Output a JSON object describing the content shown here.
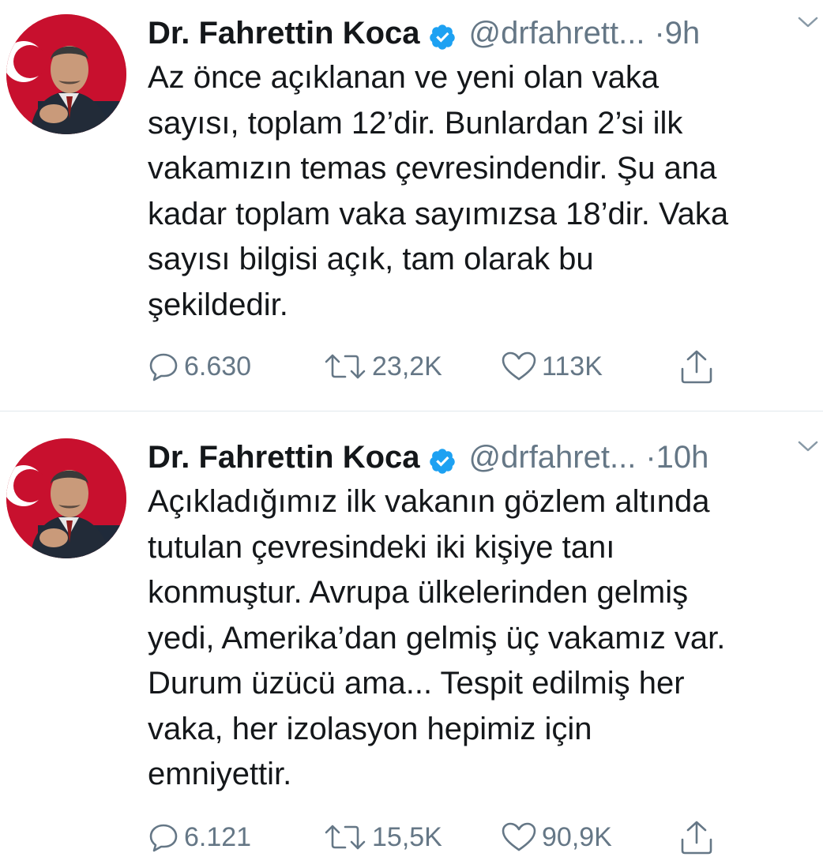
{
  "colors": {
    "text": "#14171a",
    "secondary": "#657786",
    "verified": "#1da1f2",
    "divider": "#e1e8ed"
  },
  "tweets": [
    {
      "author": {
        "name": "Dr. Fahrettin Koca",
        "handle": "@drfahrett...",
        "verified": true
      },
      "separator": "·",
      "time": "9h",
      "text": "Az önce açıklanan ve yeni olan vaka\nsayısı, toplam 12’dir. Bunlardan 2’si ilk\nvakamızın temas çevresindendir. Şu ana\nkadar toplam vaka sayımızsa 18’dir. Vaka\nsayısı bilgisi açık, tam olarak bu\nşekildedir.",
      "stats": {
        "replies": "6.630",
        "retweets": "23,2K",
        "likes": "113K"
      },
      "icons": [
        "reply-icon",
        "retweet-icon",
        "like-icon",
        "share-icon",
        "chevron-down-icon",
        "verified-badge-icon"
      ]
    },
    {
      "author": {
        "name": "Dr. Fahrettin Koca",
        "handle": "@drfahret...",
        "verified": true
      },
      "separator": "·",
      "time": "10h",
      "text": "Açıkladığımız ilk vakanın gözlem altında\ntutulan çevresindeki iki kişiye tanı\nkonmuştur. Avrupa ülkelerinden gelmiş\nyedi, Amerika’dan gelmiş üç vakamız var.\nDurum üzücü ama... Tespit edilmiş her\nvaka, her izolasyon hepimiz için\nemniyettir.",
      "stats": {
        "replies": "6.121",
        "retweets": "15,5K",
        "likes": "90,9K"
      },
      "icons": [
        "reply-icon",
        "retweet-icon",
        "like-icon",
        "share-icon",
        "chevron-down-icon",
        "verified-badge-icon"
      ]
    }
  ]
}
